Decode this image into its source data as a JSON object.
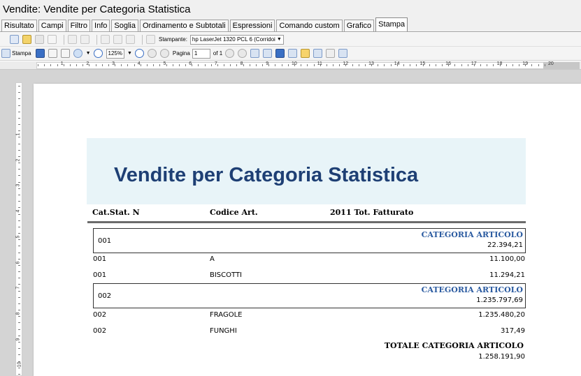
{
  "window": {
    "title": "Vendite: Vendite per Categoria Statistica"
  },
  "tabs": [
    {
      "label": "Risultato"
    },
    {
      "label": "Campi"
    },
    {
      "label": "Filtro"
    },
    {
      "label": "Info"
    },
    {
      "label": "Soglia"
    },
    {
      "label": "Ordinamento e Subtotali"
    },
    {
      "label": "Espressioni"
    },
    {
      "label": "Comando custom"
    },
    {
      "label": "Grafico"
    },
    {
      "label": "Stampa"
    }
  ],
  "active_tab": "Stampa",
  "toolbar1": {
    "printer_label": "Stampante:",
    "printer_value": "hp LaserJet 1320 PCL 6 (Corridoi"
  },
  "toolbar2": {
    "print_label": "Stampa",
    "zoom_value": "125%",
    "page_label": "Pagina",
    "page_value": "1",
    "page_of": "of 1"
  },
  "ruler": {
    "numbers": [
      "1",
      "2",
      "3",
      "4",
      "5",
      "6",
      "7",
      "8",
      "9",
      "10",
      "11",
      "12",
      "13",
      "14",
      "15",
      "16",
      "17",
      "18",
      "19",
      "20"
    ]
  },
  "report": {
    "title": "Vendite per Categoria Statistica",
    "col_headers": {
      "cat": "Cat.Stat. N",
      "code": "Codice Art.",
      "total": "2011 Tot. Fatturato"
    },
    "groups": [
      {
        "code": "001",
        "label": "CATEGORIA ARTICOLO",
        "value": "22.394,21",
        "rows": [
          {
            "cat": "001",
            "code": "A",
            "value": "11.100,00"
          },
          {
            "cat": "001",
            "code": "BISCOTTI",
            "value": "11.294,21"
          }
        ]
      },
      {
        "code": "002",
        "label": "CATEGORIA ARTICOLO",
        "value": "1.235.797,69",
        "rows": [
          {
            "cat": "002",
            "code": "FRAGOLE",
            "value": "1.235.480,20"
          },
          {
            "cat": "002",
            "code": "FUNGHI",
            "value": "317,49"
          }
        ]
      }
    ],
    "grand_total": {
      "label": "TOTALE CATEGORIA ARTICOLO",
      "value": "1.258.191,90"
    }
  },
  "colors": {
    "title": "#1e3f74",
    "group_label": "#2a5aa0",
    "title_band": "#e8f4f8"
  }
}
